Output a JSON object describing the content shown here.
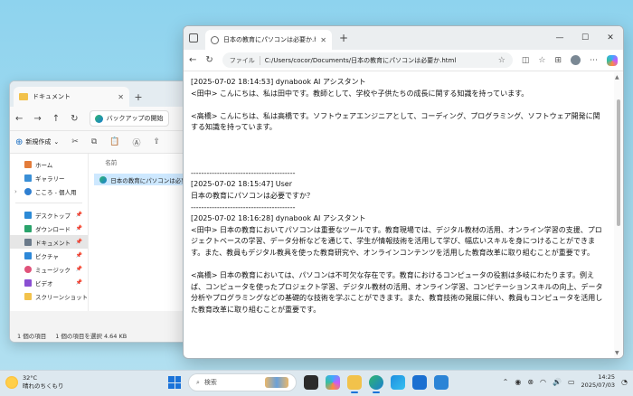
{
  "explorer": {
    "tab_title": "ドキュメント",
    "tab_close": "✕",
    "new_tab": "+",
    "nav": {
      "back": "←",
      "forward": "→",
      "up": "↑",
      "refresh": "↻"
    },
    "breadcrumb": "バックアップの開始",
    "toolbar": {
      "new_label": "新規作成",
      "new_arrow": "⌄"
    },
    "sidebar": [
      {
        "label": "ホーム",
        "color": "#e37c3a"
      },
      {
        "label": "ギャラリー",
        "color": "#3a8fd6"
      },
      {
        "label": "こころ - 個人用",
        "color": "#2f7fd1"
      },
      {
        "label": "デスクトップ",
        "color": "#2c8ad6"
      },
      {
        "label": "ダウンロード",
        "color": "#2aa36b"
      },
      {
        "label": "ドキュメント",
        "color": "#6b7a8a"
      },
      {
        "label": "ピクチャ",
        "color": "#2d88d8"
      },
      {
        "label": "ミュージック",
        "color": "#e0527a"
      },
      {
        "label": "ビデオ",
        "color": "#8a4fd2"
      },
      {
        "label": "スクリーンショット",
        "color": "#f2c24b"
      }
    ],
    "column_header": "名前",
    "file_name": "日本の教育にパソコンは必要か",
    "status": {
      "count": "1 個の項目",
      "selected": "1 個の項目を選択 4.64 KB"
    }
  },
  "edge": {
    "tab_title": "日本の教育にパソコンは必要か.html",
    "tab_close": "✕",
    "new_tab": "+",
    "window": {
      "minimize": "—",
      "maximize": "☐",
      "close": "✕"
    },
    "address": {
      "chip": "ファイル",
      "url": "C:/Users/cocor/Documents/日本の教育にパソコンは必要か.html",
      "star": "☆"
    },
    "content": [
      "[2025-07-02 18:14:53] dynabook AI アシスタント",
      "<田中> こんにちは、私は田中です。教師として、学校や子供たちの成長に関する知識を持っています。",
      "",
      "<高橋> こんにちは、私は高橋です。ソフトウェアエンジニアとして、コーディング、プログラミング、ソフトウェア開発に関する知識を持っています。",
      "",
      "",
      "",
      "----------------------------------------",
      "[2025-07-02 18:15:47] User",
      "日本の教育にパソコンは必要ですか？",
      "----------------------------------------",
      "[2025-07-02 18:16:28] dynabook AI アシスタント",
      "<田中> 日本の教育においてパソコンは重要なツールです。教育現場では、デジタル教材の活用、オンライン学習の支援、プロジェクトベースの学習、データ分析などを通じて、学生が情報技術を活用して学び、幅広いスキルを身につけることができます。また、教員もデジタル教具を使った教育研究や、オンラインコンテンツを活用した教育改革に取り組むことが重要です。",
      "",
      "<高橋> 日本の教育においては、パソコンは不可欠な存在です。教育におけるコンピュータの役割は多岐にわたります。例えば、コンピュータを使ったプロジェクト学習、デジタル教材の活用、オンライン学習、コンピテーションスキルの向上、データ分析やプログラミングなどの基礎的な技術を学ぶことができます。また、教育技術の発展に伴い、教員もコンピュータを活用した教育改革に取り組むことが重要です。"
    ]
  },
  "taskbar": {
    "weather_temp": "32°C",
    "weather_desc": "晴れのちくもり",
    "search_placeholder": "検索",
    "time": "14:25",
    "date": "2025/07/03"
  }
}
